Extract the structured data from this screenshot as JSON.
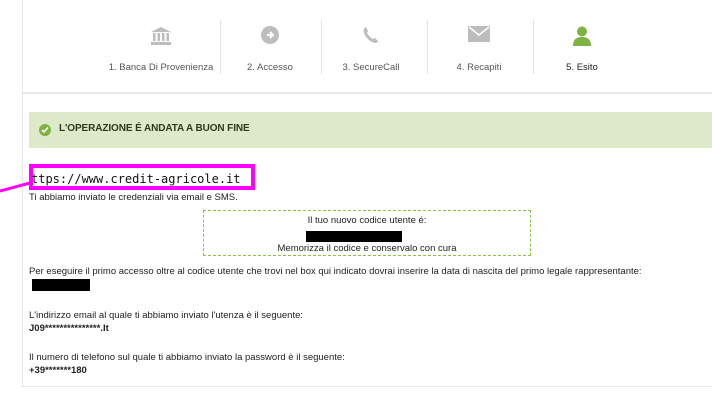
{
  "steps": [
    {
      "label": "1. Banca Di Provenienza",
      "icon": "bank-icon",
      "active": false
    },
    {
      "label": "2. Accesso",
      "icon": "arrow-right-circle-icon",
      "active": false
    },
    {
      "label": "3. SecureCall",
      "icon": "phone-icon",
      "active": false
    },
    {
      "label": "4. Recapiti",
      "icon": "envelope-icon",
      "active": false
    },
    {
      "label": "5. Esito",
      "icon": "user-icon",
      "active": true
    }
  ],
  "colors": {
    "accent_green": "#7cb342",
    "success_bg": "#dde9c9",
    "highlight": "#ff00ff",
    "icon_gray": "#bdbdbd"
  },
  "success": {
    "message": "L'OPERAZIONE É ANDATA A BUON FINE"
  },
  "url_line": "ttps://www.credit-agricole.it",
  "credentials_line": "Ti abbiamo inviato le credenziali via email e SMS.",
  "codebox": {
    "line1": "Il tuo nuovo codice utente é:",
    "line2": "Memorizza il codice e conservalo con cura"
  },
  "first_access": "Per eseguire il primo accesso oltre al codice utente che trovi nel box qui indicato dovrai inserire la data di nascita del primo legale rappresentante:",
  "email": {
    "label": "L'indirizzo email al quale ti abbiamo inviato l'utenza è il seguente:",
    "value": "J09***************.It"
  },
  "phone": {
    "label": "Il numero di telefono sul quale ti abbiamo inviato la password è il seguente:",
    "value": "+39*******180"
  }
}
